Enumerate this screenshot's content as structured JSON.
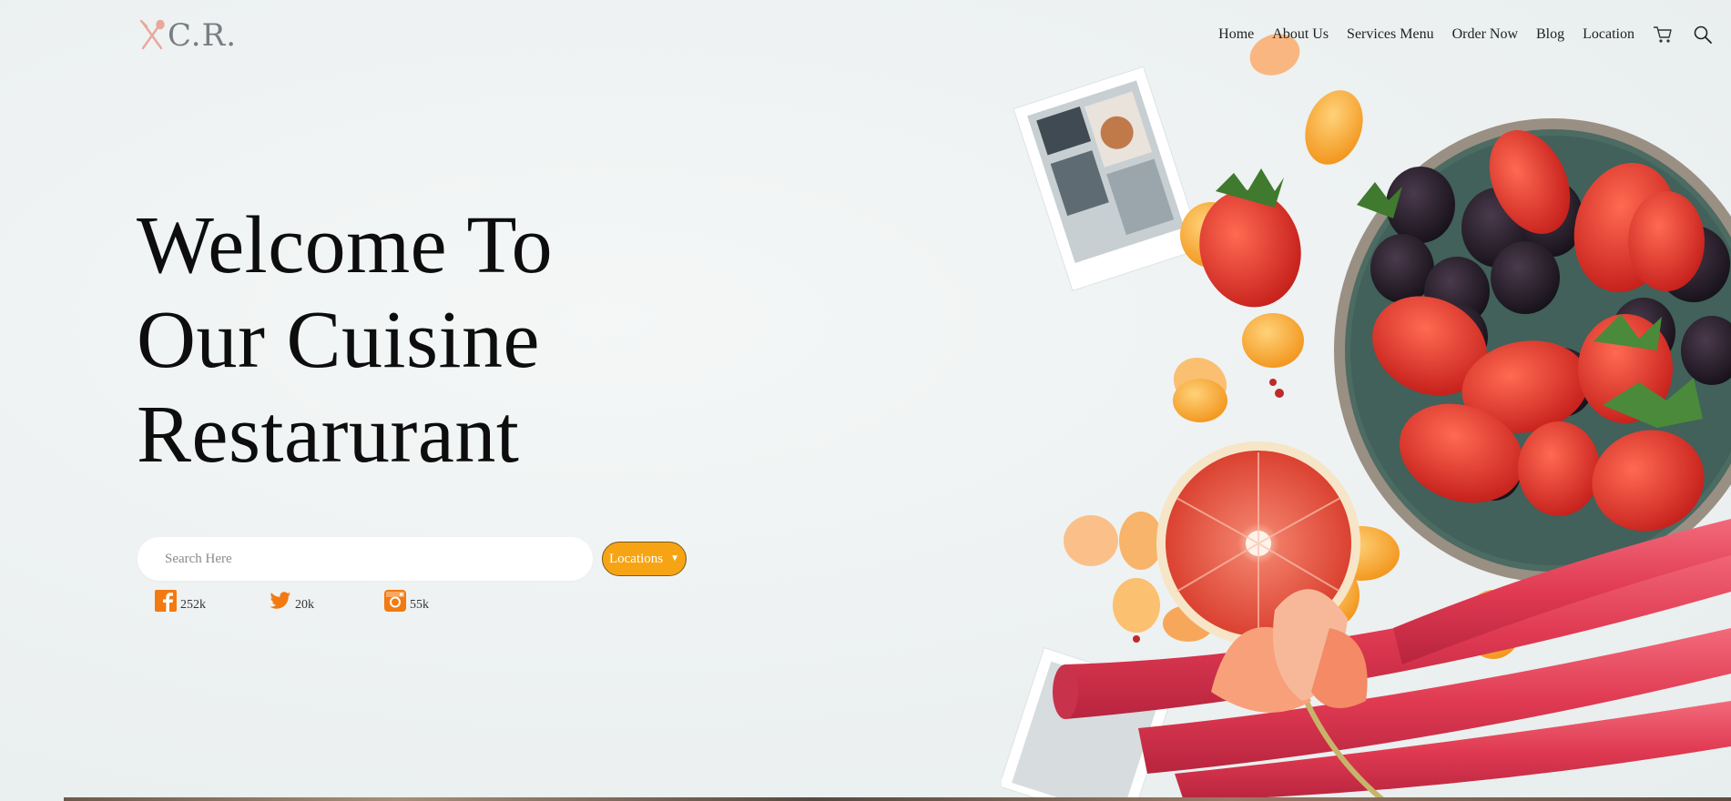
{
  "brand": {
    "logo_text": "C.R.",
    "logo_icon": "crossed-fork-spoon-icon"
  },
  "nav": {
    "items": [
      {
        "label": "Home"
      },
      {
        "label": "About Us"
      },
      {
        "label": "Services Menu"
      },
      {
        "label": "Order Now"
      },
      {
        "label": "Blog"
      },
      {
        "label": "Location"
      }
    ],
    "icons": [
      "cart-icon",
      "search-icon"
    ]
  },
  "hero": {
    "title_lines": [
      "Welcome To",
      "Our Cuisine",
      "Restarurant"
    ]
  },
  "search": {
    "placeholder": "Search Here",
    "value": "",
    "location_selected": "Locations"
  },
  "social": [
    {
      "icon": "facebook-icon",
      "count": "252k"
    },
    {
      "icon": "twitter-icon",
      "count": "20k"
    },
    {
      "icon": "instagram-icon",
      "count": "55k"
    }
  ],
  "colors": {
    "accent": "#f7a414",
    "social_icon": "#f27a10",
    "background": "#eef2f2",
    "logo_mark": "#e8a89a",
    "logo_text": "#7a7d82"
  }
}
